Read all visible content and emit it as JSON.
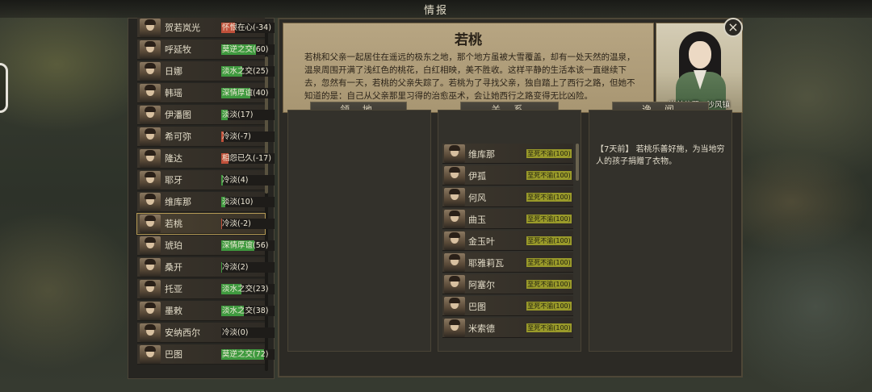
{
  "header": {
    "title": "情报"
  },
  "roster": [
    {
      "name": "贺若岚光",
      "relation": "怀恨在心(-34)",
      "color": "#c0503a",
      "level": 0.25
    },
    {
      "name": "呼延牧",
      "relation": "莫逆之交(60)",
      "color": "#3f9a3f",
      "level": 0.65
    },
    {
      "name": "日娜",
      "relation": "淡水之交(25)",
      "color": "#3f9a3f",
      "level": 0.4
    },
    {
      "name": "韩瑶",
      "relation": "深情厚谊(40)",
      "color": "#3f9a3f",
      "level": 0.55
    },
    {
      "name": "伊潘图",
      "relation": "淡淡(17)",
      "color": "#3f9a3f",
      "level": 0.12
    },
    {
      "name": "希可弥",
      "relation": "冷淡(-7)",
      "color": "#c0503a",
      "level": 0.05
    },
    {
      "name": "隆达",
      "relation": "相怨已久(-17)",
      "color": "#c0503a",
      "level": 0.14
    },
    {
      "name": "耶牙",
      "relation": "冷淡(4)",
      "color": "#3f9a3f",
      "level": 0.03
    },
    {
      "name": "维库那",
      "relation": "淡淡(10)",
      "color": "#3f9a3f",
      "level": 0.08
    },
    {
      "name": "若桃",
      "relation": "冷淡(-2)",
      "color": "#c0503a",
      "level": 0.02
    },
    {
      "name": "琥珀",
      "relation": "深情厚谊(56)",
      "color": "#3f9a3f",
      "level": 0.62
    },
    {
      "name": "桑开",
      "relation": "冷淡(2)",
      "color": "#3f9a3f",
      "level": 0.02
    },
    {
      "name": "托亚",
      "relation": "淡水之交(23)",
      "color": "#3f9a3f",
      "level": 0.38
    },
    {
      "name": "墨敕",
      "relation": "淡水之交(38)",
      "color": "#3f9a3f",
      "level": 0.42
    },
    {
      "name": "安纳西尔",
      "relation": "冷淡(0)",
      "color": "#3f9a3f",
      "level": 0
    },
    {
      "name": "巴图",
      "relation": "莫逆之交(72)",
      "color": "#3f9a3f",
      "level": 0.8
    }
  ],
  "character": {
    "name": "若桃",
    "bio": "若桃和父亲一起居住在遥远的极东之地，那个地方虽被大雪覆盖，却有一处天然的温泉，温泉周围开满了浅红色的桃花，白红相映，美不胜收。这样平静的生活本该一直继续下去，忽然有一天，若桃的父亲失踪了。若桃为了寻找父亲，独自踏上了西行之路，但她不知道的是：自己从父亲那里习得的治愈巫术，会让她西行之路变得无比凶险。",
    "location": "当前位置：沙风镇"
  },
  "sections": {
    "territory": "领 地",
    "relations": "关 系",
    "rumors": "逸 闻"
  },
  "relations": [
    {
      "name": "维库那",
      "status": "至死不渝(100)"
    },
    {
      "name": "伊孤",
      "status": "至死不渝(100)"
    },
    {
      "name": "何风",
      "status": "至死不渝(100)"
    },
    {
      "name": "曲玉",
      "status": "至死不渝(100)"
    },
    {
      "name": "金玉叶",
      "status": "至死不渝(100)"
    },
    {
      "name": "耶雅莉瓦",
      "status": "至死不渝(100)"
    },
    {
      "name": "阿塞尔",
      "status": "至死不渝(100)"
    },
    {
      "name": "巴图",
      "status": "至死不渝(100)"
    },
    {
      "name": "米索德",
      "status": "至死不渝(100)"
    }
  ],
  "rumors": [
    {
      "time": "【7天前】",
      "text": "若桃乐善好施，为当地穷人的孩子捐赠了衣物。"
    }
  ]
}
